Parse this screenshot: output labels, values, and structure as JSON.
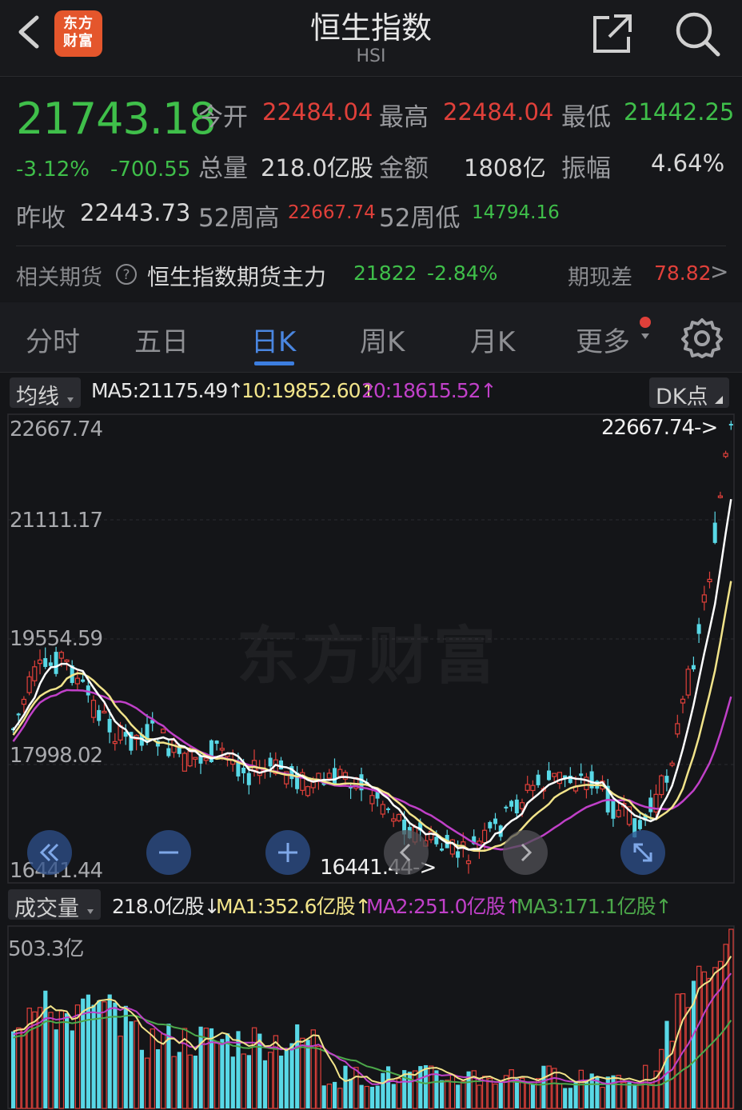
{
  "header": {
    "logo_line1": "东方",
    "logo_line2": "财富",
    "title": "恒生指数",
    "subtitle": "HSI"
  },
  "quote": {
    "price": "21743.18",
    "change_pct": "-3.12%",
    "change": "-700.55",
    "open_label": "今开",
    "open": "22484.04",
    "high_label": "最高",
    "high": "22484.04",
    "low_label": "最低",
    "low": "21442.25",
    "volume_label": "总量",
    "volume": "218.0亿股",
    "amount_label": "金额",
    "amount": "1808亿",
    "amplitude_label": "振幅",
    "amplitude": "4.64%",
    "prev_close_label": "昨收",
    "prev_close": "22443.73",
    "w52_high_label": "52周高",
    "w52_high": "22667.74",
    "w52_low_label": "52周低",
    "w52_low": "14794.16"
  },
  "futures": {
    "label": "相关期货",
    "help_icon": "?",
    "name": "恒生指数期货主力",
    "price": "21822",
    "change_pct": "-2.84%",
    "basis_label": "期现差",
    "basis": "78.82",
    "arrow": ">"
  },
  "tabs": [
    "分时",
    "五日",
    "日K",
    "周K",
    "月K",
    "更多"
  ],
  "active_tab": "日K",
  "ma_bar": {
    "chip": "均线",
    "ma5": "MA5:21175.49↑",
    "ma10": "10:19852.60↑",
    "ma20": "20:18615.52↑",
    "dk_chip": "DK点"
  },
  "kchart": {
    "y_labels": [
      "22667.74",
      "21111.17",
      "19554.59",
      "17998.02",
      "16441.44"
    ],
    "max_marker": "22667.74->",
    "min_marker": "16441.44->",
    "watermark": "东方财富"
  },
  "vol_bar": {
    "chip": "成交量",
    "vol": "218.0亿股↓",
    "ma1": "MA1:352.6亿股↑",
    "ma2": "MA2:251.0亿股↑",
    "ma3": "MA3:171.1亿股↑"
  },
  "vchart": {
    "y_label": "503.3亿"
  },
  "colors": {
    "up": "#e0403a",
    "down": "#58d8e6",
    "ma5": "#ffffff",
    "ma10": "#f2e48a",
    "ma20": "#c040c8",
    "vma3": "#4ca84a",
    "accent": "#4a86e0"
  }
}
